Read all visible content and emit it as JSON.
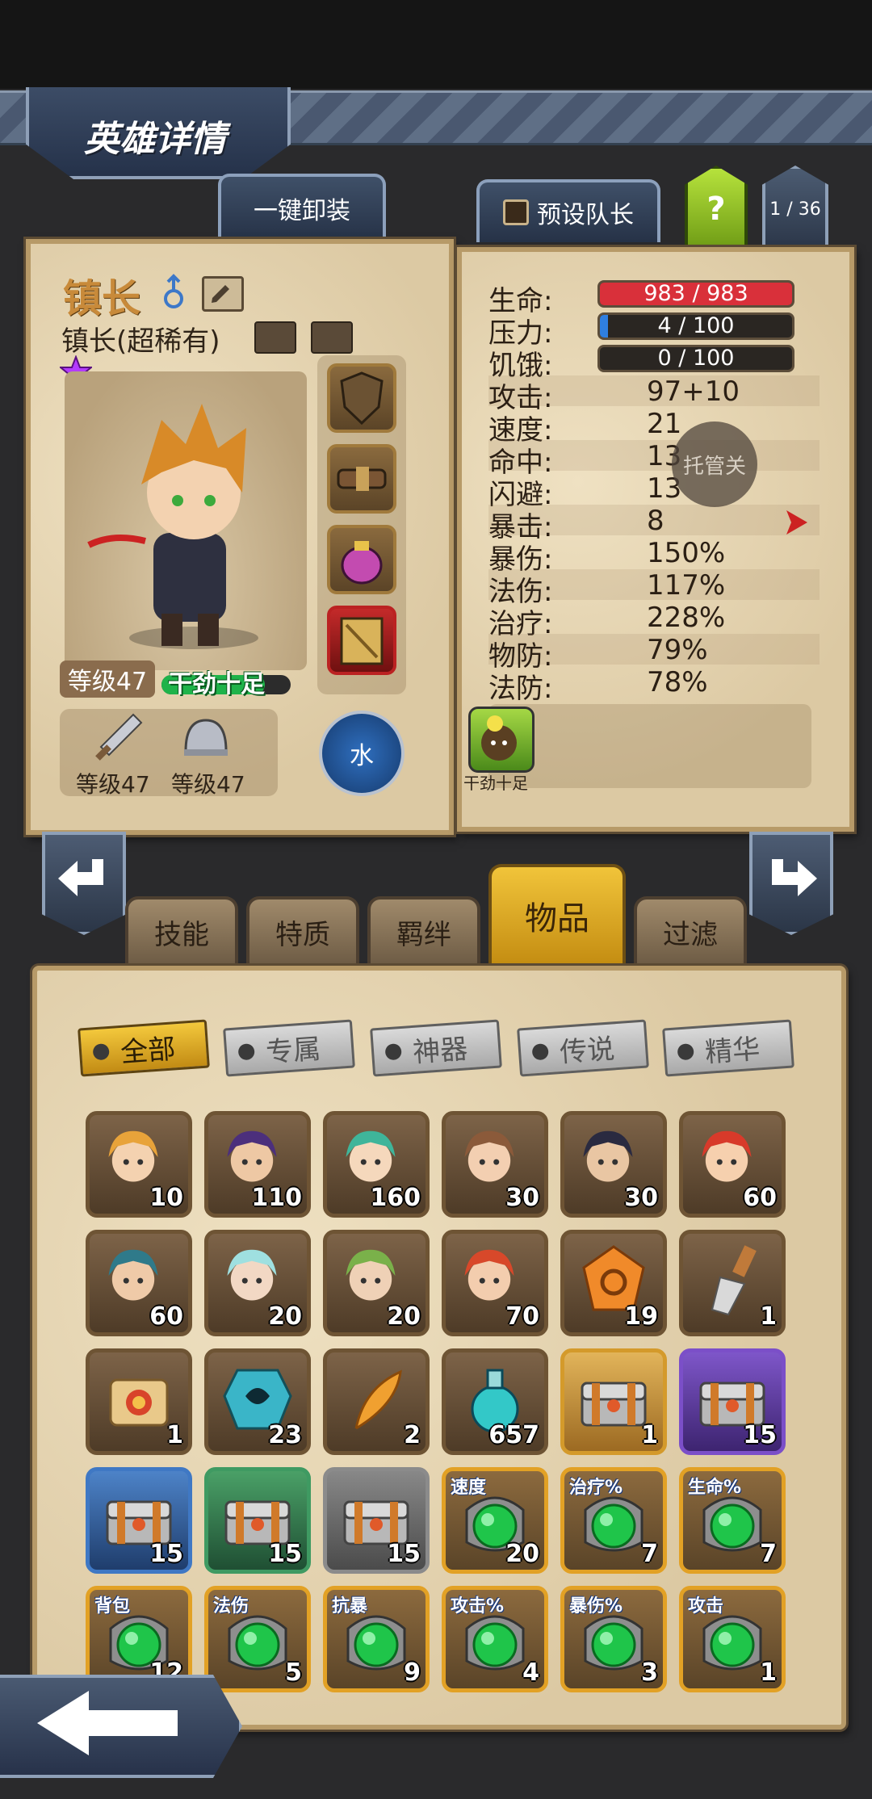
{
  "header": {
    "title": "英雄详情"
  },
  "top_buttons": {
    "unequip_all": "一键卸装",
    "preset_leader": "预设队长",
    "help": "?",
    "page": "1 / 36"
  },
  "hero": {
    "name": "镇长",
    "subtitle": "镇长(超稀有)",
    "level": "等级47",
    "status": "干劲十足",
    "element": "水",
    "weapon_level": "等级47",
    "armor_level": "等级47"
  },
  "stats": {
    "hp": {
      "label": "生命:",
      "value": "983 / 983",
      "fraction": 1.0
    },
    "stress": {
      "label": "压力:",
      "value": "4 / 100",
      "fraction": 0.04
    },
    "hunger": {
      "label": "饥饿:",
      "value": "0 / 100",
      "fraction": 0.0
    },
    "rows": [
      {
        "label": "攻击:",
        "value": "97+10"
      },
      {
        "label": "速度:",
        "value": "21"
      },
      {
        "label": "命中:",
        "value": "13"
      },
      {
        "label": "闪避:",
        "value": "13"
      },
      {
        "label": "暴击:",
        "value": "8"
      },
      {
        "label": "暴伤:",
        "value": "150%"
      },
      {
        "label": "法伤:",
        "value": "117%"
      },
      {
        "label": "治疗:",
        "value": "228%"
      },
      {
        "label": "物防:",
        "value": "79%"
      },
      {
        "label": "法防:",
        "value": "78%"
      }
    ],
    "overlay": "托管关",
    "trait_label": "干劲十足"
  },
  "tabs": [
    "技能",
    "特质",
    "羁绊",
    "物品",
    "过滤"
  ],
  "filters": [
    "全部",
    "专属",
    "神器",
    "传说",
    "精华"
  ],
  "items": [
    {
      "count": "10",
      "icon": "hero-portrait-blond"
    },
    {
      "count": "110",
      "icon": "hero-portrait-purple"
    },
    {
      "count": "160",
      "icon": "hero-portrait-green"
    },
    {
      "count": "30",
      "icon": "hero-portrait-brown"
    },
    {
      "count": "30",
      "icon": "hero-portrait-dark"
    },
    {
      "count": "60",
      "icon": "hero-portrait-red"
    },
    {
      "count": "60",
      "icon": "hero-portrait-teal"
    },
    {
      "count": "20",
      "icon": "hero-portrait-elf"
    },
    {
      "count": "20",
      "icon": "hero-portrait-green-hair"
    },
    {
      "count": "70",
      "icon": "hero-portrait-redhead"
    },
    {
      "count": "19",
      "icon": "orange-gem-icon"
    },
    {
      "count": "1",
      "icon": "chisel-icon"
    },
    {
      "count": "1",
      "icon": "scroll-icon"
    },
    {
      "count": "23",
      "icon": "rune-stone-icon"
    },
    {
      "count": "2",
      "icon": "feather-icon"
    },
    {
      "count": "657",
      "icon": "potion-icon"
    },
    {
      "count": "1",
      "icon": "gold-chest-icon"
    },
    {
      "count": "15",
      "icon": "purple-chest-icon"
    },
    {
      "count": "15",
      "icon": "blue-chest-icon"
    },
    {
      "count": "15",
      "icon": "green-chest-icon"
    },
    {
      "count": "15",
      "icon": "gray-chest-icon"
    },
    {
      "count": "20",
      "tag": "速度",
      "icon": "green-orb-icon"
    },
    {
      "count": "7",
      "tag": "治疗%",
      "icon": "green-orb-icon"
    },
    {
      "count": "7",
      "tag": "生命%",
      "icon": "green-orb-icon"
    },
    {
      "count": "12",
      "tag": "背包",
      "icon": "green-orb-icon"
    },
    {
      "count": "5",
      "tag": "法伤",
      "icon": "green-orb-icon"
    },
    {
      "count": "9",
      "tag": "抗暴",
      "icon": "green-orb-icon"
    },
    {
      "count": "4",
      "tag": "攻击%",
      "icon": "green-orb-icon"
    },
    {
      "count": "3",
      "tag": "暴伤%",
      "icon": "green-orb-icon"
    },
    {
      "count": "1",
      "tag": "攻击",
      "icon": "green-orb-icon"
    }
  ]
}
